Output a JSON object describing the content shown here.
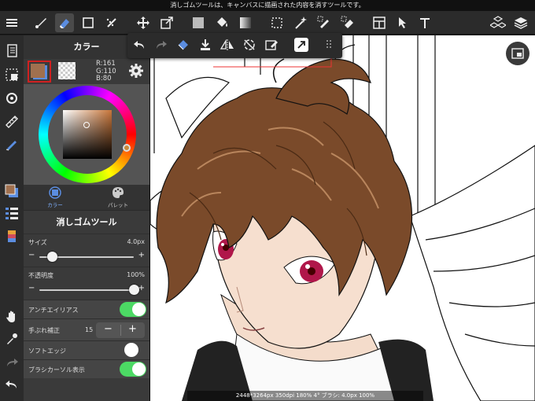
{
  "statusbar": {
    "text": "消しゴムツールは、キャンバスに描画された内容を消すツールです。"
  },
  "toolbar": {
    "tools": [
      "menu-icon",
      "brush-icon",
      "eraser-icon",
      "rect-icon",
      "dotted-brush-icon",
      "move-icon",
      "transform-icon",
      "fill-color-icon",
      "bucket-icon",
      "gradient-icon",
      "select-rect-icon",
      "magic-wand-icon",
      "select-pen-icon",
      "select-eraser-icon",
      "frame-icon",
      "select-arrow-icon",
      "text-icon",
      "materials-icon",
      "layers-icon"
    ]
  },
  "color_panel": {
    "title": "カラー",
    "fg_color": "#a0704f",
    "r": "R:161",
    "g": "G:110",
    "b": "B:80",
    "tabs": [
      {
        "label": "カラー"
      },
      {
        "label": "パレット"
      }
    ]
  },
  "tool_panel": {
    "title": "消しゴムツール",
    "size": {
      "label": "サイズ",
      "value": "4.0px",
      "level": 0.13
    },
    "opacity": {
      "label": "不透明度",
      "value": "100%",
      "level": 1.0
    },
    "antialias": {
      "label": "アンチエイリアス",
      "on": true
    },
    "stabilizer": {
      "label": "手ぶれ補正",
      "value": "15"
    },
    "soft_edge": {
      "label": "ソフトエッジ",
      "on": false
    },
    "brush_cursor": {
      "label": "ブラシカーソル表示",
      "on": true
    }
  },
  "bottom_info": {
    "text": "2448*3264px 350dpi 180% 4° ブラシ: 4.0px 100%"
  },
  "colors": {
    "accent": "#4cd964",
    "selection": "#5b8de0"
  }
}
